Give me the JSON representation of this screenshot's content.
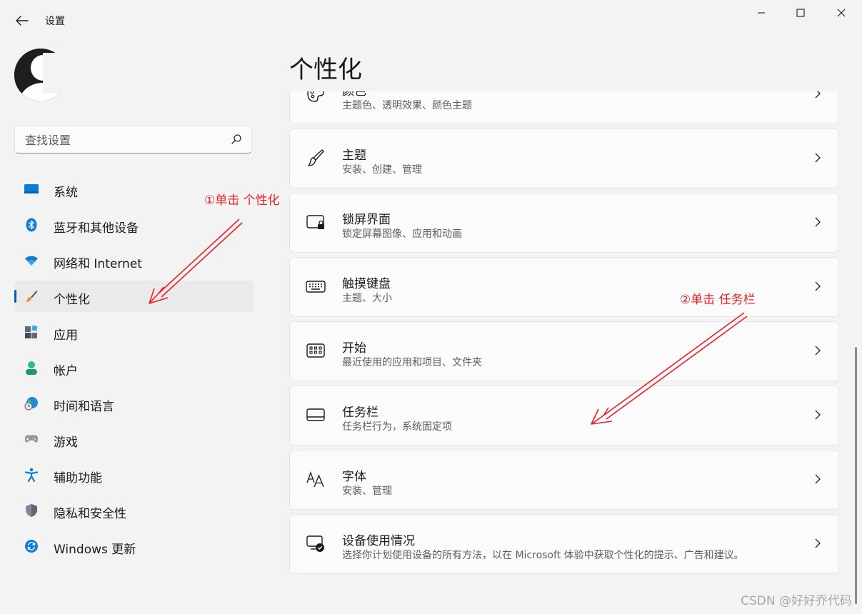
{
  "window": {
    "title": "设置"
  },
  "search": {
    "placeholder": "查找设置"
  },
  "nav": {
    "items": [
      {
        "label": "系统",
        "icon": "monitor-icon"
      },
      {
        "label": "蓝牙和其他设备",
        "icon": "bluetooth-icon"
      },
      {
        "label": "网络和 Internet",
        "icon": "wifi-icon"
      },
      {
        "label": "个性化",
        "icon": "brush-icon",
        "active": true
      },
      {
        "label": "应用",
        "icon": "apps-icon"
      },
      {
        "label": "帐户",
        "icon": "person-icon"
      },
      {
        "label": "时间和语言",
        "icon": "globe-clock-icon"
      },
      {
        "label": "游戏",
        "icon": "gamepad-icon"
      },
      {
        "label": "辅助功能",
        "icon": "accessibility-icon"
      },
      {
        "label": "隐私和安全性",
        "icon": "shield-icon"
      },
      {
        "label": "Windows 更新",
        "icon": "update-icon"
      }
    ]
  },
  "main": {
    "title": "个性化",
    "cards": [
      {
        "title": "颜色",
        "subtitle": "主题色、透明效果、颜色主题",
        "icon": "palette-icon"
      },
      {
        "title": "主题",
        "subtitle": "安装、创建、管理",
        "icon": "brush-icon"
      },
      {
        "title": "锁屏界面",
        "subtitle": "锁定屏幕图像、应用和动画",
        "icon": "lock-screen-icon"
      },
      {
        "title": "触摸键盘",
        "subtitle": "主题、大小",
        "icon": "keyboard-icon"
      },
      {
        "title": "开始",
        "subtitle": "最近使用的应用和项目、文件夹",
        "icon": "start-icon"
      },
      {
        "title": "任务栏",
        "subtitle": "任务栏行为，系统固定项",
        "icon": "taskbar-icon"
      },
      {
        "title": "字体",
        "subtitle": "安装、管理",
        "icon": "font-icon"
      },
      {
        "title": "设备使用情况",
        "subtitle": "选择你计划使用设备的所有方法，以在 Microsoft 体验中获取个性化的提示、广告和建议。",
        "icon": "device-usage-icon"
      }
    ]
  },
  "annotations": {
    "step1": "①单击  个性化",
    "step2": "②单击 任务栏",
    "color": "#e8202a"
  },
  "watermark": "CSDN @好好乔代码",
  "colors": {
    "accent": "#005fb8",
    "background": "#f3f3f3",
    "card": "#fbfbfb"
  }
}
